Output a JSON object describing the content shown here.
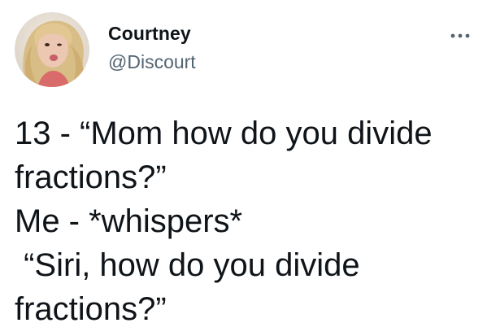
{
  "author": {
    "display_name": "Courtney",
    "handle": "@Discourt",
    "avatar_icon": "profile-photo"
  },
  "menu": {
    "icon": "more-horizontal-icon"
  },
  "tweet": {
    "lines": [
      "13 - “Mom how do you divide",
      "fractions?”",
      "Me - *whispers*",
      " “Siri, how do you divide",
      "fractions?”"
    ]
  },
  "colors": {
    "text_primary": "#0f1419",
    "text_secondary": "#536471",
    "background": "#ffffff"
  }
}
